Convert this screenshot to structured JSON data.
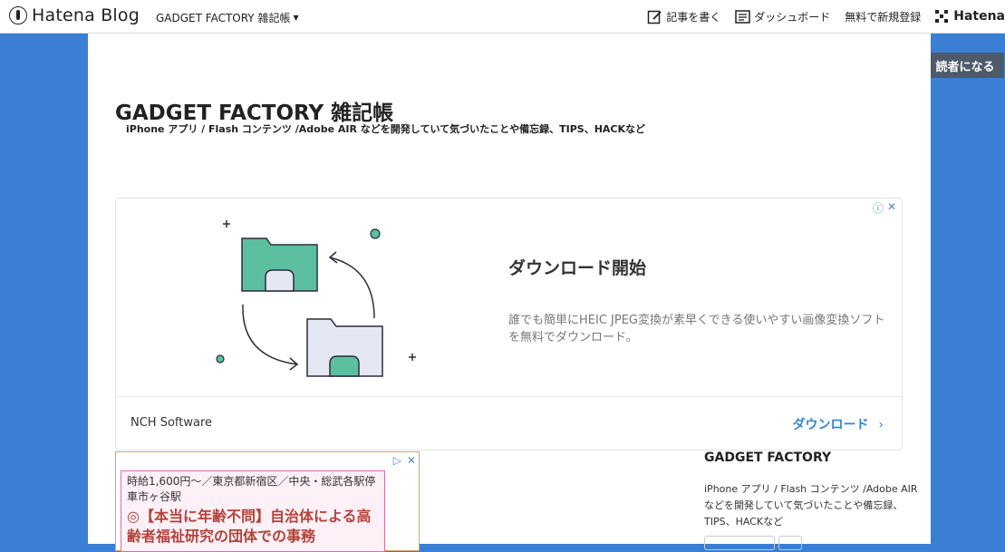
{
  "header": {
    "logo_text": "Hatena Blog",
    "blog_menu_label": "GADGET FACTORY 雑記帳",
    "write_label": "記事を書く",
    "dashboard_label": "ダッシュボード",
    "signup_label": "無料で新規登録",
    "hatena_label": "Hatena"
  },
  "subscribe_label": "読者になる",
  "blog": {
    "title": "GADGET FACTORY 雑記帳",
    "description": "iPhone アプリ / Flash コンテンツ /Adobe AIR などを開発していて気づいたことや備忘録、TIPS、HACKなど"
  },
  "ad_main": {
    "headline": "ダウンロード開始",
    "body": "誰でも簡単にHEIC JPEG変換が素早くできる使いやすい画像変換ソフトを無料でダウンロード。",
    "advertiser": "NCH Software",
    "cta": "ダウンロード",
    "icons": [
      "info-icon",
      "close-icon"
    ],
    "illustration_colors": {
      "folder": "#5bbfa0",
      "paper": "#e5e7f3",
      "outline": "#2a2f3a"
    }
  },
  "ad_secondary": {
    "line1": "時給1,600円〜／東京都新宿区／中央・総武各駅停車市ヶ谷駅",
    "line2": "◎【本当に年齢不問】自治体による高齢者福祉研究の団体での事務"
  },
  "sidebar": {
    "title": "GADGET FACTORY",
    "description": "iPhone アプリ / Flash コンテンツ /Adobe AIR などを開発していて気づいたことや備忘録、TIPS、HACKなど"
  },
  "colors": {
    "background": "#3a7fd5",
    "accent": "#2f86d6",
    "subscribe_bg": "#4c5a6a"
  }
}
